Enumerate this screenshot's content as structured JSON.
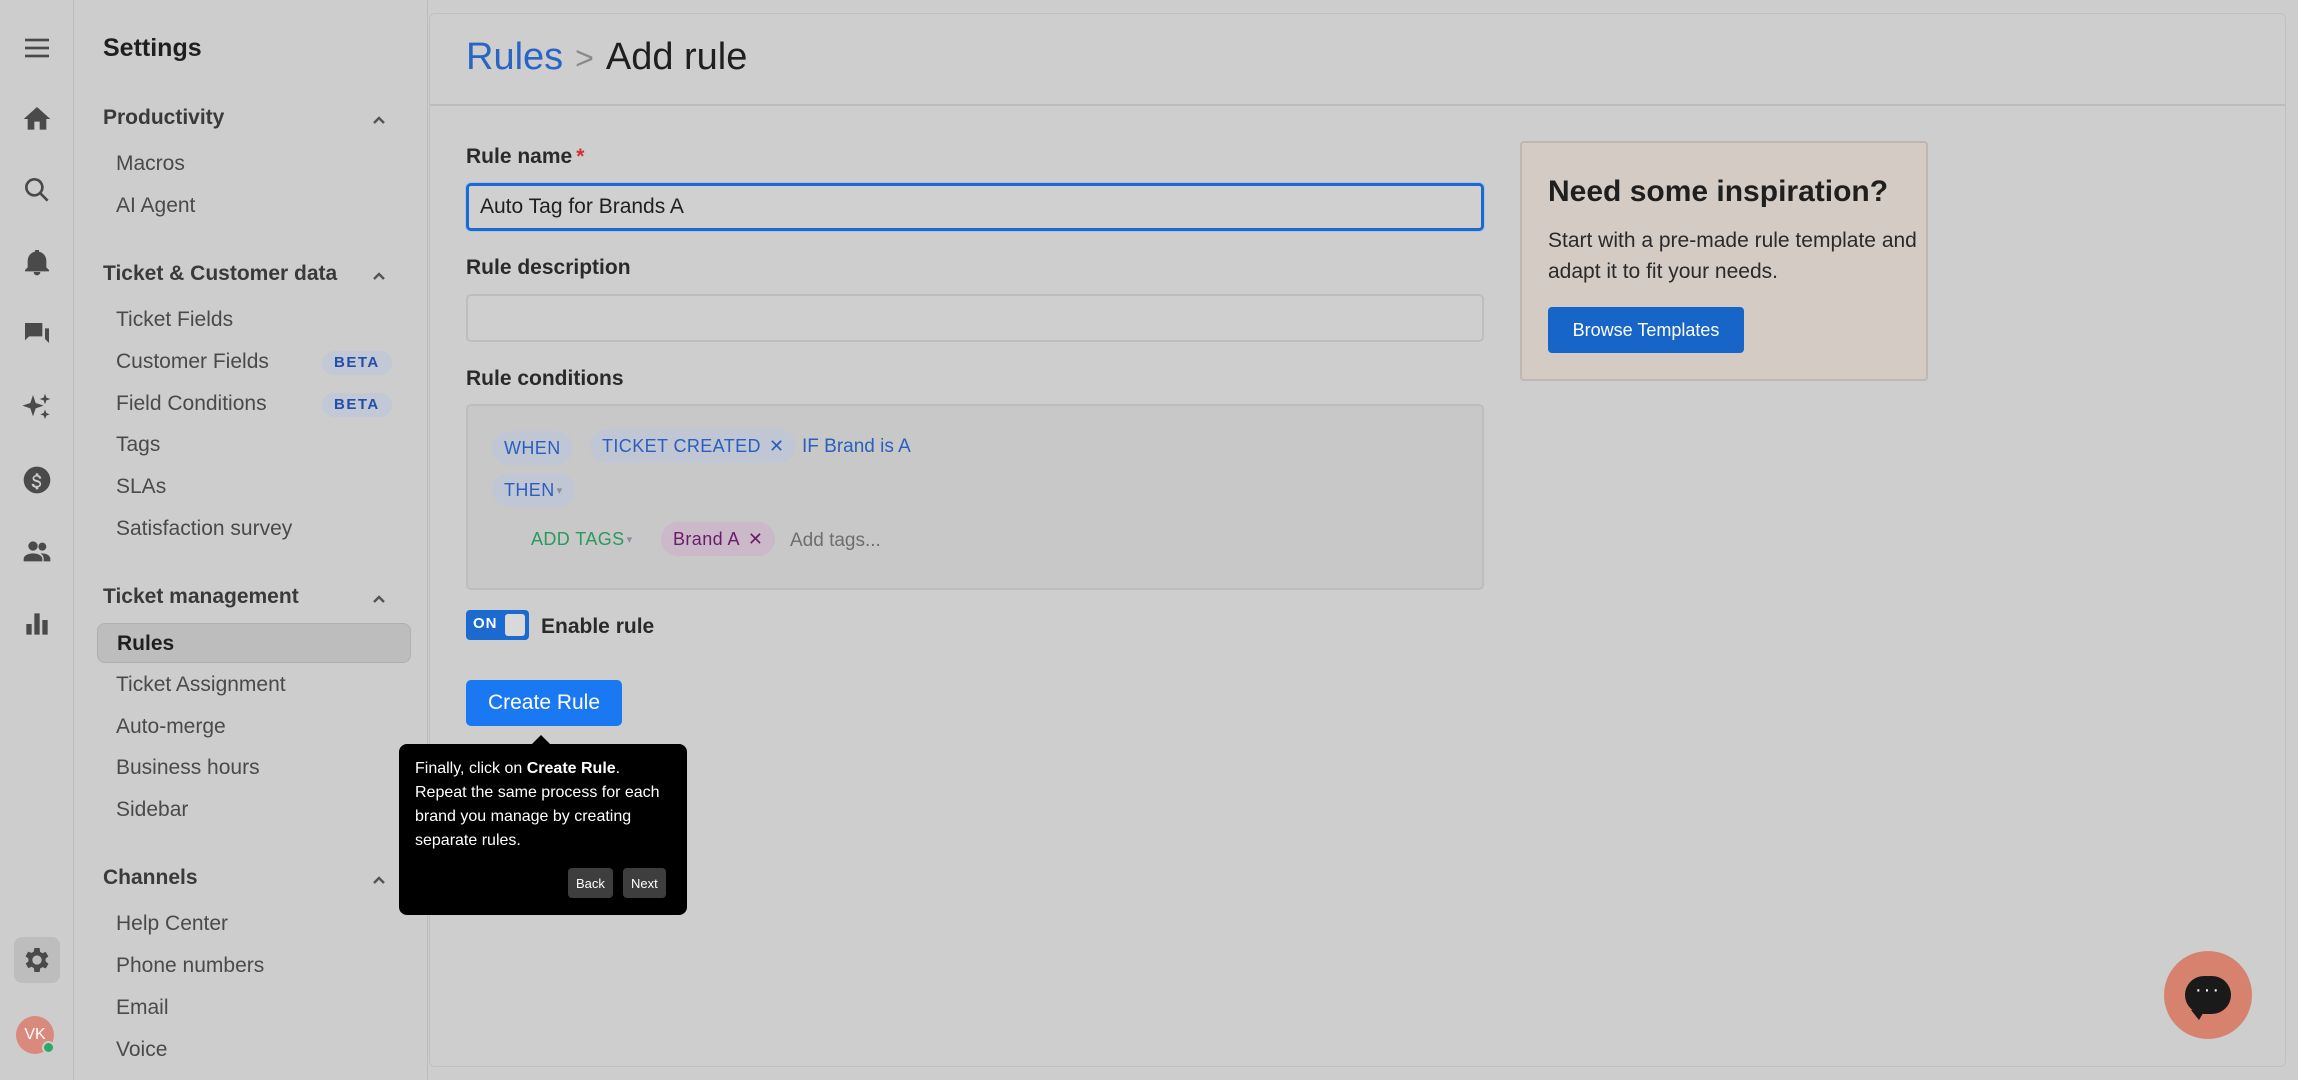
{
  "sidebar": {
    "title": "Settings",
    "sections": [
      {
        "label": "Productivity",
        "items": [
          {
            "label": "Macros"
          },
          {
            "label": "AI Agent"
          }
        ]
      },
      {
        "label": "Ticket & Customer data",
        "items": [
          {
            "label": "Ticket Fields"
          },
          {
            "label": "Customer Fields",
            "badge": "BETA"
          },
          {
            "label": "Field Conditions",
            "badge": "BETA"
          },
          {
            "label": "Tags"
          },
          {
            "label": "SLAs"
          },
          {
            "label": "Satisfaction survey"
          }
        ]
      },
      {
        "label": "Ticket management",
        "items": [
          {
            "label": "Rules",
            "active": true
          },
          {
            "label": "Ticket Assignment"
          },
          {
            "label": "Auto-merge"
          },
          {
            "label": "Business hours"
          },
          {
            "label": "Sidebar"
          }
        ]
      },
      {
        "label": "Channels",
        "items": [
          {
            "label": "Help Center"
          },
          {
            "label": "Phone numbers"
          },
          {
            "label": "Email"
          },
          {
            "label": "Voice"
          }
        ]
      }
    ]
  },
  "user": {
    "initials": "VK",
    "status": "online"
  },
  "breadcrumb": {
    "parent": "Rules",
    "separator": ">",
    "current": "Add rule"
  },
  "form": {
    "rule_name_label": "Rule name",
    "required_marker": "*",
    "rule_name_value": "Auto Tag for Brands A",
    "rule_description_label": "Rule description",
    "rule_description_value": "",
    "rule_conditions_label": "Rule conditions",
    "conditions": {
      "when": "WHEN",
      "trigger": "TICKET CREATED",
      "if_text": "IF Brand is A",
      "then": "THEN",
      "action": "ADD TAGS",
      "tag": "Brand A",
      "add_tags_placeholder": "Add tags..."
    },
    "toggle_state": "ON",
    "enable_label": "Enable rule",
    "create_button": "Create Rule"
  },
  "inspiration": {
    "title": "Need some inspiration?",
    "text": "Start with a pre-made rule template and adapt it to fit your needs.",
    "button": "Browse Templates"
  },
  "tooltip": {
    "text_before": "Finally, click on ",
    "text_bold": "Create Rule",
    "text_after": ". Repeat the same process for each brand you manage by creating separate rules.",
    "back": "Back",
    "next": "Next"
  },
  "chat": {
    "dots": "···"
  },
  "colors": {
    "primary": "#1a78f2",
    "link": "#2a64c4",
    "green": "#2b9a5c",
    "purple": "#6a1c6a"
  }
}
